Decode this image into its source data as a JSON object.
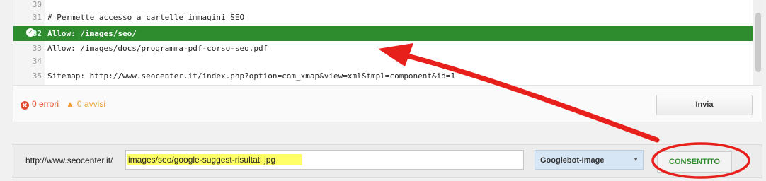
{
  "editor": {
    "lines": [
      {
        "num": "30",
        "text": ""
      },
      {
        "num": "31",
        "text": "# Permette accesso a cartelle immagini SEO"
      },
      {
        "num": "32",
        "text": "Allow: /images/seo/"
      },
      {
        "num": "33",
        "text": "Allow: /images/docs/programma-pdf-corso-seo.pdf"
      },
      {
        "num": "34",
        "text": ""
      },
      {
        "num": "35",
        "text": "Sitemap: http://www.seocenter.it/index.php?option=com_xmap&view=xml&tmpl=component&id=1"
      }
    ],
    "highlight_color": "#2e8b2e"
  },
  "status": {
    "errors": "0 errori",
    "warnings": "0 avvisi",
    "submit_label": "Invia"
  },
  "tester": {
    "url_prefix": "http://www.seocenter.it/",
    "url_value": "images/seo/google-suggest-risultati.jpg",
    "bot_selected": "Googlebot-Image",
    "result_label": "CONSENTITO",
    "result_color": "#2e8b2e"
  },
  "annotation": {
    "arrow_color": "#e8201c"
  }
}
